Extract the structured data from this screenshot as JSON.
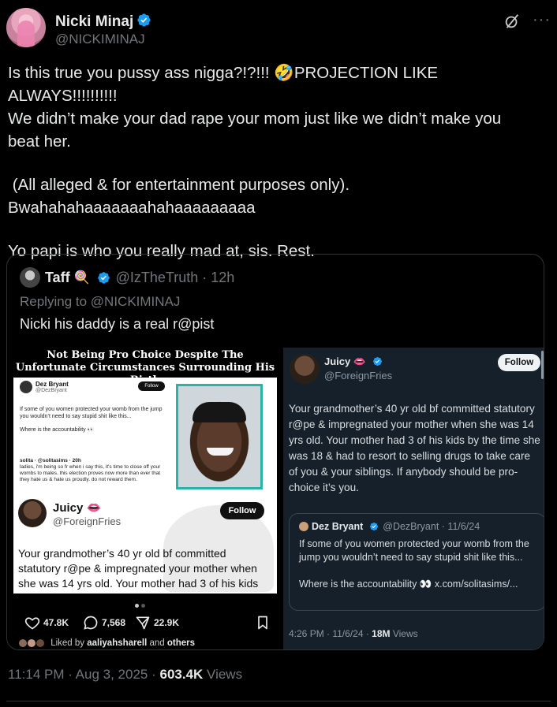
{
  "post": {
    "author_name": "Nicki Minaj",
    "author_handle": "@NICKIMINAJ",
    "more_label": "···",
    "text_lines": [
      "Is this true you pussy ass nigga?!?!!! 🤣PROJECTION LIKE ALWAYS!!!!!!!!!!",
      "We didn’t make your dad rape your mom just like we didn’t make you",
      "beat her."
    ],
    "text_p2_lines": [
      " (All alleged & for entertainment purposes only).",
      "Bwahahahaaaaaaahahaaaaaaaaa"
    ],
    "text_p3": "Yo papi is who you really mad at, sis. Rest.",
    "time": "11:14 PM · Aug 3, 2025 · ",
    "views": "603.4K",
    "views_label": " Views"
  },
  "quote": {
    "author_name": "Taff",
    "author_emoji": "🍭",
    "author_handle": "@IzTheTruth · 12h",
    "replying_prefix": "Replying to ",
    "replying_handle": "@NICKIMINAJ",
    "text": "Nicki his daddy is a real r@pist"
  },
  "media_left": {
    "banner": "Not Being Pro Choice Despite The Unfortunate Circumstances Surrounding His Birth",
    "inner_name": "Dez Bryant",
    "inner_handle": "@DezBryant",
    "inner_follow": "Follow",
    "inner_body": "If some of you women protected your womb from the jump you wouldn’t need to say stupid shit like this...",
    "inner_body2": "Where is the accountability 👀",
    "inner_quote_author": "solita · @solitasims · 20h",
    "inner_quote": "ladies, i'm being so fr when i say this, it's time to close off your wombs to males. this election proves now more than ever that they hate us & hate us proudly. do not reward them.",
    "juicy_name": "Juicy 👄",
    "juicy_handle": "@ForeignFries",
    "juicy_follow": "Follow",
    "juicy_text": "Your grandmother’s 40 yr old bf committed statutory r@pe & impregnated your mother when she was 14 yrs old. Your mother had 3 of his kids",
    "likes": "47.8K",
    "replies": "7,568",
    "shares": "22.9K",
    "liked_by_prefix": "Liked by ",
    "liked_by_user": "aaliyahsharell",
    "liked_by_suffix": " and ",
    "liked_by_others": "others"
  },
  "media_right": {
    "name": "Juicy 👄",
    "handle": "@ForeignFries",
    "follow": "Follow",
    "text": "Your grandmother’s 40 yr old bf committed statutory r@pe & impregnated your mother when she was 14 yrs old. Your mother had 3 of his kids by the time she was 18 & had to resort to selling drugs to take care of you & your siblings. If anybody should be pro-choice it’s you.",
    "quote_name": "Dez Bryant",
    "quote_handle": "@DezBryant · 11/6/24",
    "quote_body": "If some of you women protected your womb from the jump you wouldn’t need to say stupid shit like this...",
    "quote_body2": "Where is the accountability 👀 x.com/solitasims/...",
    "time": "4:26 PM · 11/6/24 · ",
    "views": "18M",
    "views_label": " Views"
  },
  "colors": {
    "background": "#000000",
    "text": "#e7e9ea",
    "muted": "#71767b",
    "verified": "#1d9bf0",
    "border": "#2f3336"
  }
}
